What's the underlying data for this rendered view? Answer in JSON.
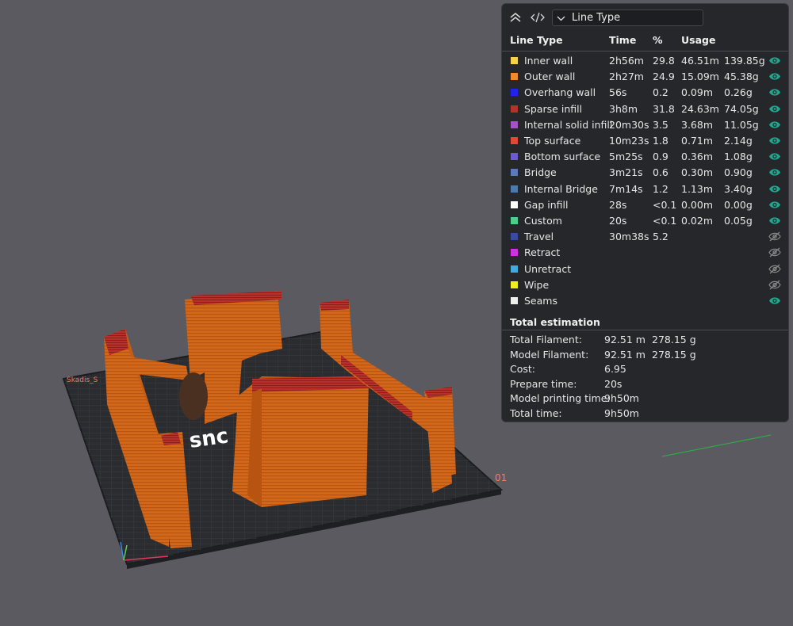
{
  "toolbar": {
    "view_type": "Line Type"
  },
  "headers": {
    "line_type": "Line Type",
    "time": "Time",
    "percent": "%",
    "usage": "Usage"
  },
  "line_types": [
    {
      "name": "Inner wall",
      "color": "#f5d04a",
      "time": "2h56m",
      "percent": "29.8",
      "length": "46.51m",
      "weight": "139.85g",
      "visible": true
    },
    {
      "name": "Outer wall",
      "color": "#f08a30",
      "time": "2h27m",
      "percent": "24.9",
      "length": "15.09m",
      "weight": "45.38g",
      "visible": true
    },
    {
      "name": "Overhang wall",
      "color": "#2222ee",
      "time": "56s",
      "percent": "0.2",
      "length": "0.09m",
      "weight": "0.26g",
      "visible": true
    },
    {
      "name": "Sparse infill",
      "color": "#b8302a",
      "time": "3h8m",
      "percent": "31.8",
      "length": "24.63m",
      "weight": "74.05g",
      "visible": true
    },
    {
      "name": "Internal solid infill",
      "color": "#a850c8",
      "time": "20m30s",
      "percent": "3.5",
      "length": "3.68m",
      "weight": "11.05g",
      "visible": true
    },
    {
      "name": "Top surface",
      "color": "#e8443a",
      "time": "10m23s",
      "percent": "1.8",
      "length": "0.71m",
      "weight": "2.14g",
      "visible": true
    },
    {
      "name": "Bottom surface",
      "color": "#6a5ccc",
      "time": "5m25s",
      "percent": "0.9",
      "length": "0.36m",
      "weight": "1.08g",
      "visible": true
    },
    {
      "name": "Bridge",
      "color": "#5a7ab8",
      "time": "3m21s",
      "percent": "0.6",
      "length": "0.30m",
      "weight": "0.90g",
      "visible": true
    },
    {
      "name": "Internal Bridge",
      "color": "#4a7ab0",
      "time": "7m14s",
      "percent": "1.2",
      "length": "1.13m",
      "weight": "3.40g",
      "visible": true
    },
    {
      "name": "Gap infill",
      "color": "#ffffff",
      "time": "28s",
      "percent": "<0.1",
      "length": "0.00m",
      "weight": "0.00g",
      "visible": true
    },
    {
      "name": "Custom",
      "color": "#4ecc8a",
      "time": "20s",
      "percent": "<0.1",
      "length": "0.02m",
      "weight": "0.05g",
      "visible": true
    },
    {
      "name": "Travel",
      "color": "#3a4aa0",
      "time": "30m38s",
      "percent": "5.2",
      "length": "",
      "weight": "",
      "visible": false
    },
    {
      "name": "Retract",
      "color": "#cc33dd",
      "time": "",
      "percent": "",
      "length": "",
      "weight": "",
      "visible": false
    },
    {
      "name": "Unretract",
      "color": "#44aadd",
      "time": "",
      "percent": "",
      "length": "",
      "weight": "",
      "visible": false
    },
    {
      "name": "Wipe",
      "color": "#eeee22",
      "time": "",
      "percent": "",
      "length": "",
      "weight": "",
      "visible": false
    },
    {
      "name": "Seams",
      "color": "#eeeeee",
      "time": "",
      "percent": "",
      "length": "",
      "weight": "",
      "visible": true
    }
  ],
  "total": {
    "title": "Total estimation",
    "rows": [
      {
        "label": "Total Filament:",
        "v1": "92.51 m",
        "v2": "278.15 g"
      },
      {
        "label": "Model Filament:",
        "v1": "92.51 m",
        "v2": "278.15 g"
      },
      {
        "label": "Cost:",
        "v1": "6.95",
        "v2": ""
      },
      {
        "label": "Prepare time:",
        "v1": "20s",
        "v2": ""
      },
      {
        "label": "Model printing time:",
        "v1": "9h50m",
        "v2": ""
      },
      {
        "label": "Total time:",
        "v1": "9h50m",
        "v2": ""
      }
    ]
  },
  "scene": {
    "plate_label": "Skadis_S",
    "plate_logo": "snc",
    "plate_number": "01",
    "colors": {
      "background": "#5a5a60",
      "plate": "#2e2f33",
      "model": "#d86a1a",
      "accent_eye": "#1fa890"
    }
  }
}
